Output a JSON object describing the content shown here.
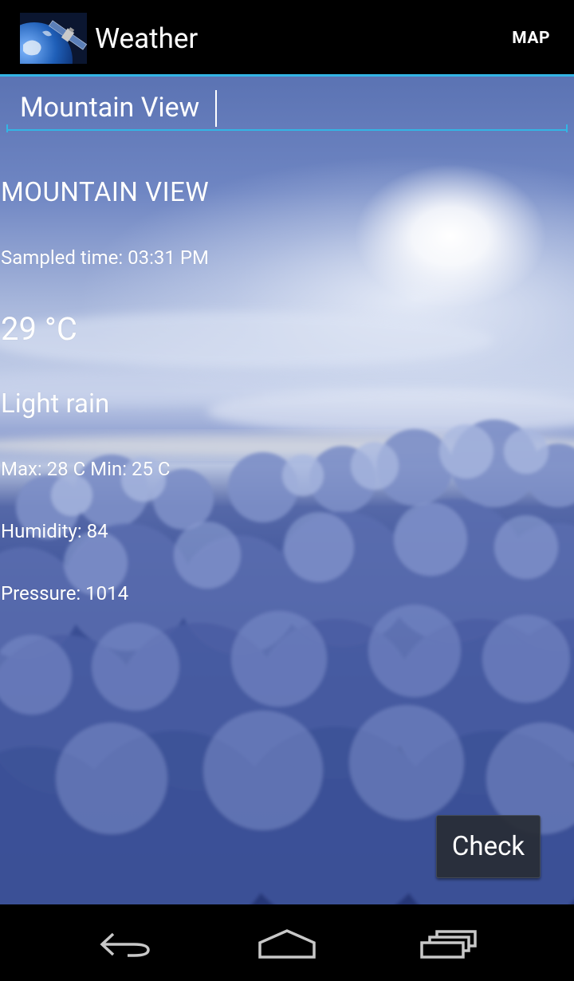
{
  "action_bar": {
    "title": "Weather",
    "map_label": "MAP",
    "accent_color": "#33b5e5"
  },
  "search": {
    "value": "Mountain View"
  },
  "weather": {
    "city": "MOUNTAIN VIEW",
    "sampled_time": "Sampled time: 03:31 PM",
    "temperature": "29 °C",
    "description": "Light rain",
    "max_min": "Max: 28 C  Min: 25 C",
    "humidity": "Humidity: 84",
    "pressure": "Pressure: 1014"
  },
  "check_button": {
    "label": "Check"
  },
  "nav_bar": {
    "icons": [
      "back-icon",
      "home-icon",
      "recent-apps-icon"
    ]
  }
}
